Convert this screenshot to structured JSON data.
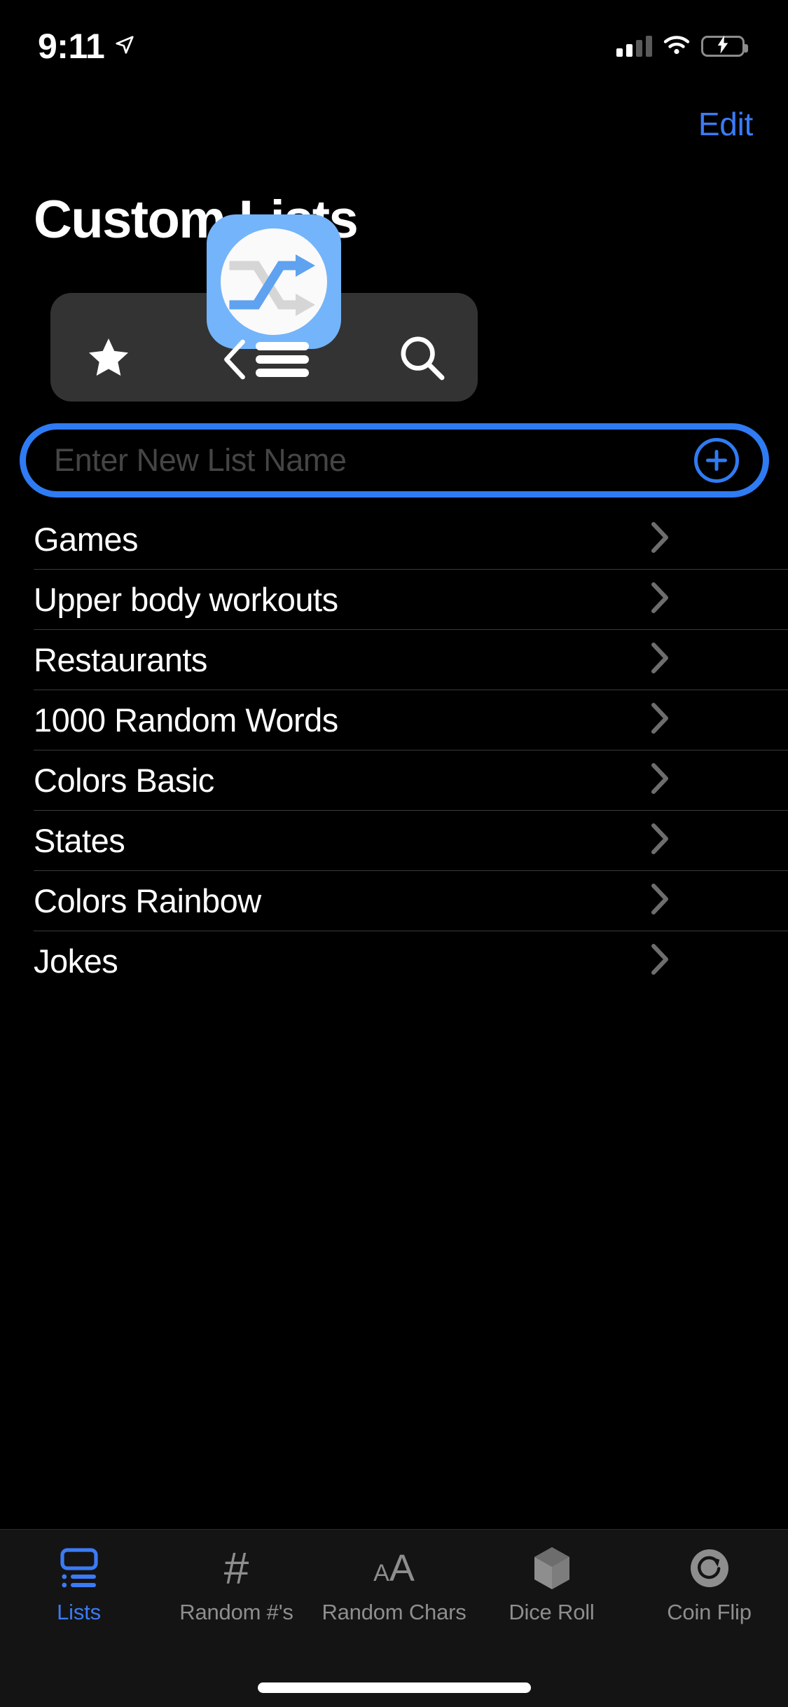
{
  "status_bar": {
    "time": "9:11",
    "location_icon": "location-arrow-icon",
    "cellular_icon": "cellular-signal-icon",
    "cellular_bars_filled": 2,
    "cellular_bars_total": 4,
    "wifi_icon": "wifi-icon",
    "battery_icon": "battery-charging-icon",
    "battery_color": "#4cd964"
  },
  "nav": {
    "edit_label": "Edit",
    "accent_color": "#3b7bf6"
  },
  "header": {
    "title": "Custom Lists"
  },
  "app_card": {
    "icon_name": "shuffle-app-icon",
    "icon_bg": "#74b4fa",
    "card_bg": "#333333",
    "tools": [
      {
        "name": "favorite-star-icon",
        "label": "star"
      },
      {
        "name": "back-to-list-icon",
        "label": "back-list"
      },
      {
        "name": "search-icon",
        "label": "search"
      }
    ]
  },
  "new_list": {
    "placeholder": "Enter New List Name",
    "value": "",
    "add_icon": "plus-circle-icon",
    "border_color": "#2f7bf3"
  },
  "lists": [
    {
      "label": "Games",
      "chevron": "chevron-right-icon"
    },
    {
      "label": "Upper body workouts",
      "chevron": "chevron-right-icon"
    },
    {
      "label": "Restaurants",
      "chevron": "chevron-right-icon"
    },
    {
      "label": "1000 Random Words",
      "chevron": "chevron-right-icon"
    },
    {
      "label": "Colors Basic",
      "chevron": "chevron-right-icon"
    },
    {
      "label": "States",
      "chevron": "chevron-right-icon"
    },
    {
      "label": "Colors Rainbow",
      "chevron": "chevron-right-icon"
    },
    {
      "label": "Jokes",
      "chevron": "chevron-right-icon"
    }
  ],
  "tab_bar": {
    "active_index": 0,
    "active_color": "#3b7bf6",
    "inactive_color": "#8e8e8e",
    "tabs": [
      {
        "label": "Lists",
        "icon": "list-view-icon"
      },
      {
        "label": "Random #'s",
        "icon": "hash-icon"
      },
      {
        "label": "Random Chars",
        "icon": "text-size-icon"
      },
      {
        "label": "Dice Roll",
        "icon": "cube-dice-icon"
      },
      {
        "label": "Coin Flip",
        "icon": "coin-flip-icon"
      }
    ]
  }
}
